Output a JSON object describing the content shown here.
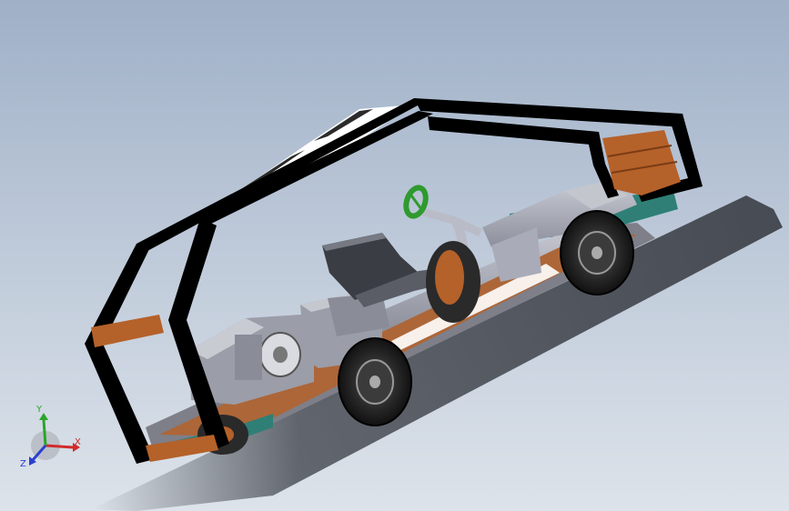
{
  "viewport": {
    "title": "",
    "background_top": "#9fb0c7",
    "background_bottom": "#dde3ea"
  },
  "model": {
    "frame_color": "#000000",
    "roof_color": "#ffffff",
    "wood_color": "#b5612a",
    "metal_color": "#a9abb8",
    "accent_color": "#2f7f76",
    "steering_wheel_color": "#2f9a2f"
  },
  "triad": {
    "x_label": "X",
    "y_label": "Y",
    "z_label": "Z",
    "x_color": "#d12a2a",
    "y_color": "#2aa52a",
    "z_color": "#2a3fd1"
  }
}
